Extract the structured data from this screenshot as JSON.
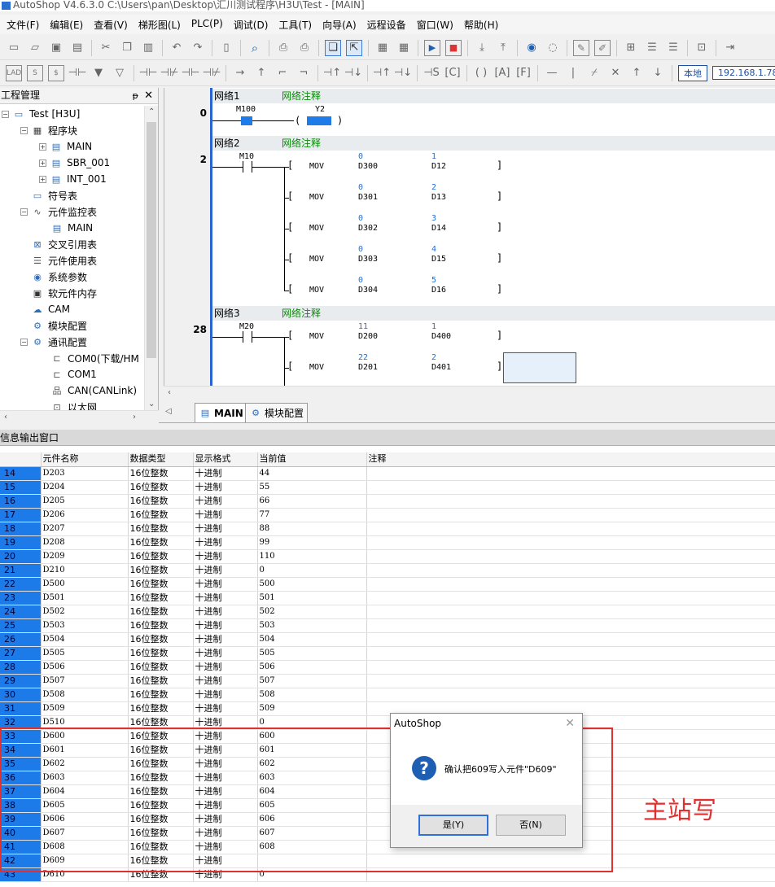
{
  "window": {
    "title": "AutoShop V4.6.3.0  C:\\Users\\pan\\Desktop\\汇川测试程序\\H3U\\Test - [MAIN]"
  },
  "menu": [
    "文件(F)",
    "编辑(E)",
    "查看(V)",
    "梯形图(L)",
    "PLC(P)",
    "调试(D)",
    "工具(T)",
    "向导(A)",
    "远程设备",
    "窗口(W)",
    "帮助(H)"
  ],
  "toolbar2": {
    "lad_label": "LAD",
    "local_label": "本地",
    "ip": "192.168.1.78"
  },
  "project_panel": {
    "title": "工程管理",
    "pin": "ᵽ",
    "close": "✕",
    "tree": [
      {
        "label": "Test [H3U]",
        "icon": "monitor-icon"
      },
      {
        "label": "程序块",
        "icon": "program-block-icon"
      },
      {
        "label": "MAIN",
        "icon": "ladder-file-icon"
      },
      {
        "label": "SBR_001",
        "icon": "ladder-file-icon"
      },
      {
        "label": "INT_001",
        "icon": "ladder-file-icon"
      },
      {
        "label": "符号表",
        "icon": "symbol-table-icon"
      },
      {
        "label": "元件监控表",
        "icon": "monitor-table-icon"
      },
      {
        "label": "MAIN",
        "icon": "monitor-file-icon"
      },
      {
        "label": "交叉引用表",
        "icon": "cross-reference-icon"
      },
      {
        "label": "元件使用表",
        "icon": "database-icon"
      },
      {
        "label": "系统参数",
        "icon": "system-params-icon"
      },
      {
        "label": "软元件内存",
        "icon": "memory-icon"
      },
      {
        "label": "CAM",
        "icon": "cam-icon"
      },
      {
        "label": "模块配置",
        "icon": "module-config-icon"
      },
      {
        "label": "通讯配置",
        "icon": "comm-config-icon"
      },
      {
        "label": "COM0(下载/HM",
        "icon": "serial-port-icon"
      },
      {
        "label": "COM1",
        "icon": "serial-port-icon"
      },
      {
        "label": "CAN(CANLink)",
        "icon": "can-network-icon"
      },
      {
        "label": "以太网",
        "icon": "ethernet-icon"
      }
    ]
  },
  "ladder": {
    "networks": [
      {
        "name": "网络1",
        "comment": "网络注释",
        "step": "0"
      },
      {
        "name": "网络2",
        "comment": "网络注释",
        "step": "2"
      },
      {
        "name": "网络3",
        "comment": "网络注释",
        "step": "28"
      }
    ],
    "n1": {
      "contact": "M100",
      "coil": "Y2"
    },
    "n2": {
      "contact": "M10",
      "rows": [
        {
          "op": "MOV",
          "src_val": "0",
          "src": "D300",
          "dst_val": "1",
          "dst": "D12"
        },
        {
          "op": "MOV",
          "src_val": "0",
          "src": "D301",
          "dst_val": "2",
          "dst": "D13"
        },
        {
          "op": "MOV",
          "src_val": "0",
          "src": "D302",
          "dst_val": "3",
          "dst": "D14"
        },
        {
          "op": "MOV",
          "src_val": "0",
          "src": "D303",
          "dst_val": "4",
          "dst": "D15"
        },
        {
          "op": "MOV",
          "src_val": "0",
          "src": "D304",
          "dst_val": "5",
          "dst": "D16"
        }
      ]
    },
    "n3": {
      "contact": "M20",
      "rows": [
        {
          "op": "MOV",
          "src_val": "11",
          "src": "D200",
          "dst_val": "1",
          "dst": "D400"
        },
        {
          "op": "MOV",
          "src_val": "22",
          "src": "D201",
          "dst_val": "2",
          "dst": "D401"
        }
      ]
    }
  },
  "tabs": [
    {
      "label": "MAIN"
    },
    {
      "label": "模块配置"
    }
  ],
  "output": {
    "title": "信息输出窗口",
    "columns": [
      "",
      "元件名称",
      "数据类型",
      "显示格式",
      "当前值",
      "注释"
    ],
    "rows": [
      [
        "14",
        "D203",
        "16位整数",
        "十进制",
        "44"
      ],
      [
        "15",
        "D204",
        "16位整数",
        "十进制",
        "55"
      ],
      [
        "16",
        "D205",
        "16位整数",
        "十进制",
        "66"
      ],
      [
        "17",
        "D206",
        "16位整数",
        "十进制",
        "77"
      ],
      [
        "18",
        "D207",
        "16位整数",
        "十进制",
        "88"
      ],
      [
        "19",
        "D208",
        "16位整数",
        "十进制",
        "99"
      ],
      [
        "20",
        "D209",
        "16位整数",
        "十进制",
        "110"
      ],
      [
        "21",
        "D210",
        "16位整数",
        "十进制",
        "0"
      ],
      [
        "22",
        "D500",
        "16位整数",
        "十进制",
        "500"
      ],
      [
        "23",
        "D501",
        "16位整数",
        "十进制",
        "501"
      ],
      [
        "24",
        "D502",
        "16位整数",
        "十进制",
        "502"
      ],
      [
        "25",
        "D503",
        "16位整数",
        "十进制",
        "503"
      ],
      [
        "26",
        "D504",
        "16位整数",
        "十进制",
        "504"
      ],
      [
        "27",
        "D505",
        "16位整数",
        "十进制",
        "505"
      ],
      [
        "28",
        "D506",
        "16位整数",
        "十进制",
        "506"
      ],
      [
        "29",
        "D507",
        "16位整数",
        "十进制",
        "507"
      ],
      [
        "30",
        "D508",
        "16位整数",
        "十进制",
        "508"
      ],
      [
        "31",
        "D509",
        "16位整数",
        "十进制",
        "509"
      ],
      [
        "32",
        "D510",
        "16位整数",
        "十进制",
        "0"
      ],
      [
        "33",
        "D600",
        "16位整数",
        "十进制",
        "600"
      ],
      [
        "34",
        "D601",
        "16位整数",
        "十进制",
        "601"
      ],
      [
        "35",
        "D602",
        "16位整数",
        "十进制",
        "602"
      ],
      [
        "36",
        "D603",
        "16位整数",
        "十进制",
        "603"
      ],
      [
        "37",
        "D604",
        "16位整数",
        "十进制",
        "604"
      ],
      [
        "38",
        "D605",
        "16位整数",
        "十进制",
        "605"
      ],
      [
        "39",
        "D606",
        "16位整数",
        "十进制",
        "606"
      ],
      [
        "40",
        "D607",
        "16位整数",
        "十进制",
        "607"
      ],
      [
        "41",
        "D608",
        "16位整数",
        "十进制",
        "608"
      ],
      [
        "42",
        "D609",
        "16位整数",
        "十进制",
        ""
      ],
      [
        "43",
        "D610",
        "16位整数",
        "十进制",
        "0"
      ]
    ]
  },
  "dialog": {
    "title": "AutoShop",
    "message": "确认把609写入元件\"D609\"",
    "yes": "是(Y)",
    "no": "否(N)"
  },
  "annotation": "主站写",
  "colors": {
    "accent_blue": "#1c7be8",
    "highlight_red": "#e03030",
    "comment_green": "#0a8a0a"
  }
}
